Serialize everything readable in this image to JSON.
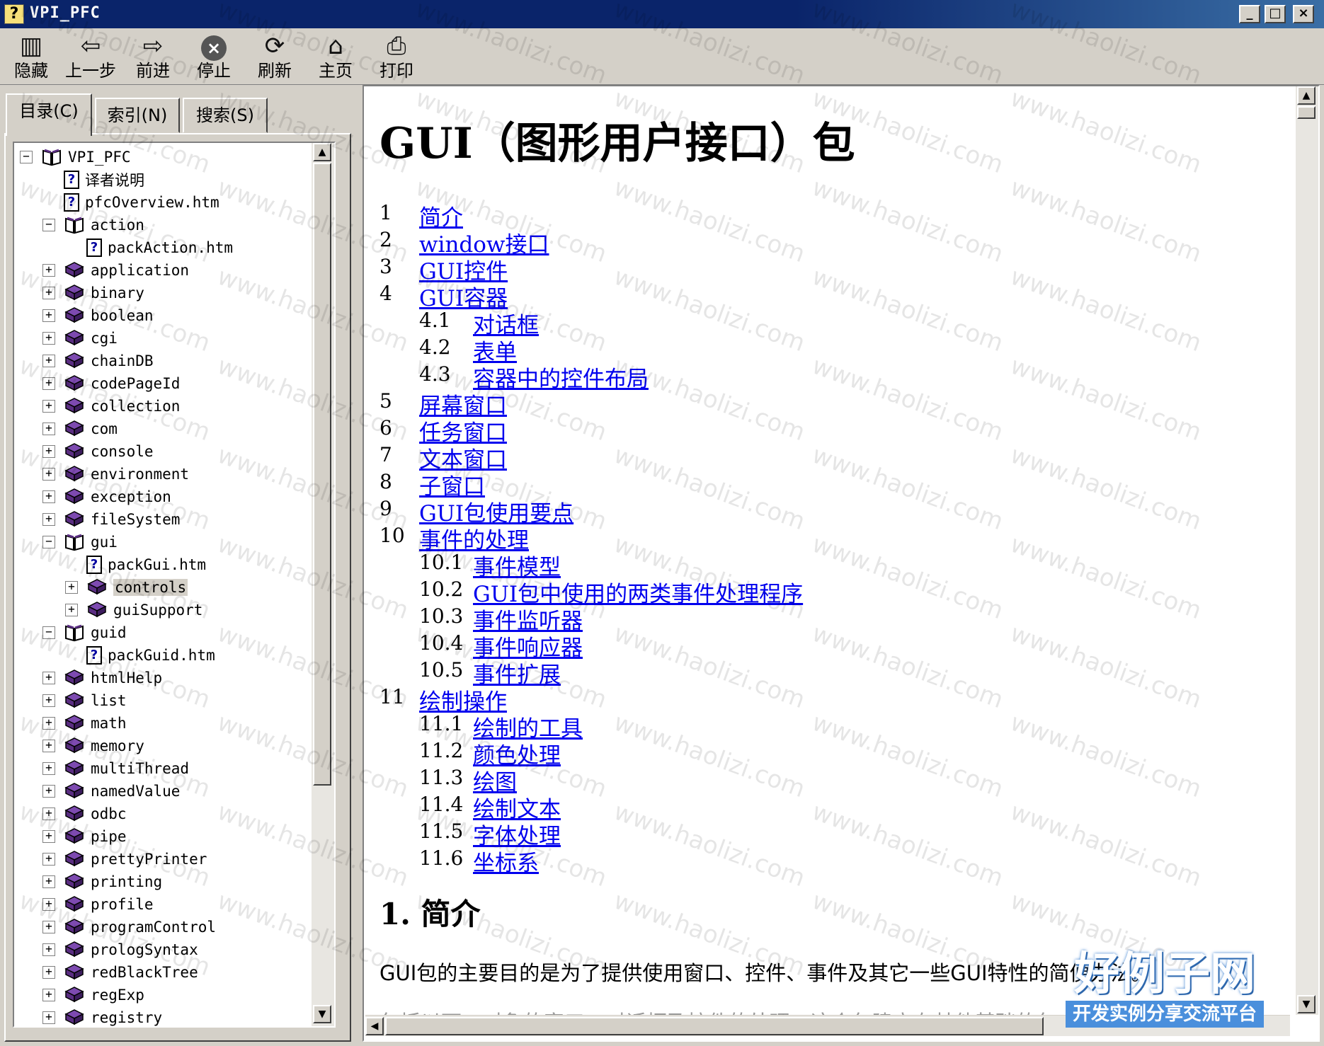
{
  "window": {
    "title": "VPI_PFC",
    "minimize": "_",
    "maximize": "□",
    "close": "×"
  },
  "toolbar": [
    {
      "id": "hide",
      "label": "隐藏",
      "icon": "hide-pane-icon",
      "glyph": "▥"
    },
    {
      "id": "back",
      "label": "上一步",
      "icon": "back-arrow-icon",
      "glyph": "⇦"
    },
    {
      "id": "forward",
      "label": "前进",
      "icon": "forward-arrow-icon",
      "glyph": "⇨"
    },
    {
      "id": "stop",
      "label": "停止",
      "icon": "stop-icon",
      "glyph": "×"
    },
    {
      "id": "refresh",
      "label": "刷新",
      "icon": "refresh-icon",
      "glyph": "⟳"
    },
    {
      "id": "home",
      "label": "主页",
      "icon": "home-icon",
      "glyph": "⌂"
    },
    {
      "id": "print",
      "label": "打印",
      "icon": "printer-icon",
      "glyph": "⎙"
    }
  ],
  "tabs": [
    {
      "id": "contents",
      "label": "目录(C)",
      "active": true
    },
    {
      "id": "index",
      "label": "索引(N)",
      "active": false
    },
    {
      "id": "search",
      "label": "搜索(S)",
      "active": false
    }
  ],
  "tree": [
    {
      "label": "VPI_PFC",
      "level": 0,
      "type": "book-open",
      "expander": "−"
    },
    {
      "label": "译者说明",
      "level": 1,
      "type": "page",
      "expander": ""
    },
    {
      "label": "pfcOverview.htm",
      "level": 1,
      "type": "page",
      "expander": ""
    },
    {
      "label": "action",
      "level": 1,
      "type": "book-open",
      "expander": "−"
    },
    {
      "label": "packAction.htm",
      "level": 2,
      "type": "page",
      "expander": ""
    },
    {
      "label": "application",
      "level": 1,
      "type": "book",
      "expander": "+"
    },
    {
      "label": "binary",
      "level": 1,
      "type": "book",
      "expander": "+"
    },
    {
      "label": "boolean",
      "level": 1,
      "type": "book",
      "expander": "+"
    },
    {
      "label": "cgi",
      "level": 1,
      "type": "book",
      "expander": "+"
    },
    {
      "label": "chainDB",
      "level": 1,
      "type": "book",
      "expander": "+"
    },
    {
      "label": "codePageId",
      "level": 1,
      "type": "book",
      "expander": "+"
    },
    {
      "label": "collection",
      "level": 1,
      "type": "book",
      "expander": "+"
    },
    {
      "label": "com",
      "level": 1,
      "type": "book",
      "expander": "+"
    },
    {
      "label": "console",
      "level": 1,
      "type": "book",
      "expander": "+"
    },
    {
      "label": "environment",
      "level": 1,
      "type": "book",
      "expander": "+"
    },
    {
      "label": "exception",
      "level": 1,
      "type": "book",
      "expander": "+"
    },
    {
      "label": "fileSystem",
      "level": 1,
      "type": "book",
      "expander": "+"
    },
    {
      "label": "gui",
      "level": 1,
      "type": "book-open",
      "expander": "−"
    },
    {
      "label": "packGui.htm",
      "level": 2,
      "type": "page",
      "expander": ""
    },
    {
      "label": "controls",
      "level": 2,
      "type": "book",
      "expander": "+",
      "selected": true
    },
    {
      "label": "guiSupport",
      "level": 2,
      "type": "book",
      "expander": "+"
    },
    {
      "label": "guid",
      "level": 1,
      "type": "book-open",
      "expander": "−"
    },
    {
      "label": "packGuid.htm",
      "level": 2,
      "type": "page",
      "expander": ""
    },
    {
      "label": "htmlHelp",
      "level": 1,
      "type": "book",
      "expander": "+"
    },
    {
      "label": "list",
      "level": 1,
      "type": "book",
      "expander": "+"
    },
    {
      "label": "math",
      "level": 1,
      "type": "book",
      "expander": "+"
    },
    {
      "label": "memory",
      "level": 1,
      "type": "book",
      "expander": "+"
    },
    {
      "label": "multiThread",
      "level": 1,
      "type": "book",
      "expander": "+"
    },
    {
      "label": "namedValue",
      "level": 1,
      "type": "book",
      "expander": "+"
    },
    {
      "label": "odbc",
      "level": 1,
      "type": "book",
      "expander": "+"
    },
    {
      "label": "pipe",
      "level": 1,
      "type": "book",
      "expander": "+"
    },
    {
      "label": "prettyPrinter",
      "level": 1,
      "type": "book",
      "expander": "+"
    },
    {
      "label": "printing",
      "level": 1,
      "type": "book",
      "expander": "+"
    },
    {
      "label": "profile",
      "level": 1,
      "type": "book",
      "expander": "+"
    },
    {
      "label": "programControl",
      "level": 1,
      "type": "book",
      "expander": "+"
    },
    {
      "label": "prologSyntax",
      "level": 1,
      "type": "book",
      "expander": "+"
    },
    {
      "label": "redBlackTree",
      "level": 1,
      "type": "book",
      "expander": "+"
    },
    {
      "label": "regExp",
      "level": 1,
      "type": "book",
      "expander": "+"
    },
    {
      "label": "registry",
      "level": 1,
      "type": "book",
      "expander": "+"
    }
  ],
  "content": {
    "title": "GUI（图形用户接口）包",
    "toc": [
      {
        "num": "1",
        "text": "简介",
        "level": 0
      },
      {
        "num": "2",
        "text": "window接口",
        "level": 0
      },
      {
        "num": "3",
        "text": "GUI控件",
        "level": 0
      },
      {
        "num": "4",
        "text": "GUI容器",
        "level": 0
      },
      {
        "num": "4.1",
        "text": "对话框",
        "level": 1
      },
      {
        "num": "4.2",
        "text": "表单",
        "level": 1
      },
      {
        "num": "4.3",
        "text": "容器中的控件布局",
        "level": 1
      },
      {
        "num": "5",
        "text": "屏幕窗口",
        "level": 0
      },
      {
        "num": "6",
        "text": "任务窗口",
        "level": 0
      },
      {
        "num": "7",
        "text": "文本窗口",
        "level": 0
      },
      {
        "num": "8",
        "text": "子窗口",
        "level": 0
      },
      {
        "num": "9",
        "text": "GUI包使用要点",
        "level": 0
      },
      {
        "num": "10",
        "text": "事件的处理",
        "level": 0
      },
      {
        "num": "10.1",
        "text": "事件模型",
        "level": 1
      },
      {
        "num": "10.2",
        "text": "GUI包中使用的两类事件处理程序",
        "level": 1
      },
      {
        "num": "10.3",
        "text": "事件监听器",
        "level": 1
      },
      {
        "num": "10.4",
        "text": "事件响应器",
        "level": 1
      },
      {
        "num": "10.5",
        "text": "事件扩展",
        "level": 1
      },
      {
        "num": "11",
        "text": "绘制操作",
        "level": 0
      },
      {
        "num": "11.1",
        "text": "绘制的工具",
        "level": 1
      },
      {
        "num": "11.2",
        "text": "颜色处理",
        "level": 1
      },
      {
        "num": "11.3",
        "text": "绘图",
        "level": 1
      },
      {
        "num": "11.4",
        "text": "绘制文本",
        "level": 1
      },
      {
        "num": "11.5",
        "text": "字体处理",
        "level": 1
      },
      {
        "num": "11.6",
        "text": "坐标系",
        "level": 1
      }
    ],
    "section_heading": "1. 简介",
    "paragraph": "GUI包的主要目的是为了提供使用窗口、控件、事件及其它一些GUI特性的简便办法。",
    "paragraph_partial": "包括以下：对象的窗口、对话框及控件的处理，这个包建立在其他基础的包之上..."
  },
  "branding": {
    "name": "好例子网",
    "tagline": "开发实例分享交流平台"
  },
  "watermark_text": "www.haolizi.com",
  "colors": {
    "titlebar": "#0a246a",
    "link": "#0000ee",
    "book": "#5a2d82",
    "chrome": "#d4d0c8"
  }
}
